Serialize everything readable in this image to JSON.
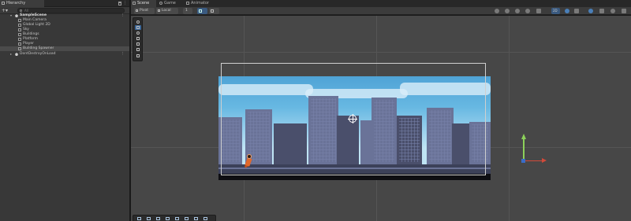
{
  "hierarchy": {
    "tab_label": "Hierarchy",
    "menu": "⋮",
    "add_symbol": "+▾",
    "search_placeholder": "All",
    "scene_name": "SampleScene",
    "items": [
      {
        "label": "Main Camera"
      },
      {
        "label": "Global Light 2D"
      },
      {
        "label": "Sky"
      },
      {
        "label": "Buildings"
      },
      {
        "label": "Platform"
      },
      {
        "label": "Player"
      },
      {
        "label": "Building Spawner",
        "selected": true
      }
    ],
    "dont_destroy": "DontDestroyOnLoad"
  },
  "tabs": [
    {
      "label": "Scene",
      "active": true
    },
    {
      "label": "Game"
    },
    {
      "label": "Animator"
    }
  ],
  "toolbar": {
    "pivot_label": "Pivot",
    "local_label": "Local",
    "snap_value": "1",
    "mode_2d": "2D"
  },
  "colors": {
    "accent": "#3e6a9c",
    "axis_y": "#8cd15a",
    "axis_x": "#d14a3a"
  }
}
